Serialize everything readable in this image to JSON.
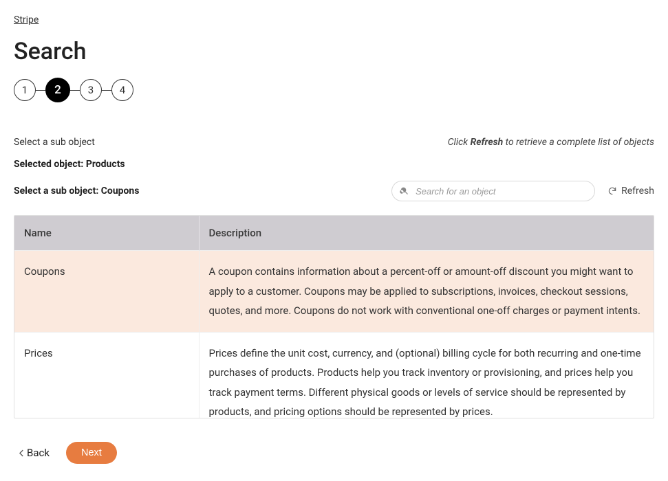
{
  "breadcrumb": "Stripe",
  "page_title": "Search",
  "stepper": {
    "steps": [
      "1",
      "2",
      "3",
      "4"
    ],
    "active_index": 1
  },
  "instruction_left": "Select a sub object",
  "instruction_right": {
    "prefix": "Click ",
    "bold": "Refresh",
    "suffix": " to retrieve a complete list of objects"
  },
  "selected_object_line": "Selected object: Products",
  "sub_object_line": "Select a sub object: Coupons",
  "search": {
    "placeholder": "Search for an object"
  },
  "refresh_label": "Refresh",
  "table": {
    "headers": {
      "name": "Name",
      "description": "Description"
    },
    "rows": [
      {
        "name": "Coupons",
        "description": "A coupon contains information about a percent-off or amount-off discount you might want to apply to a customer. Coupons may be applied to subscriptions, invoices, checkout sessions, quotes, and more. Coupons do not work with conventional one-off charges or payment intents.",
        "selected": true
      },
      {
        "name": "Prices",
        "description": "Prices define the unit cost, currency, and (optional) billing cycle for both recurring and one-time purchases of products. Products help you track inventory or provisioning, and prices help you track payment terms. Different physical goods or levels of service should be represented by products, and pricing options should be represented by prices.",
        "selected": false
      }
    ]
  },
  "footer": {
    "back": "Back",
    "next": "Next"
  }
}
